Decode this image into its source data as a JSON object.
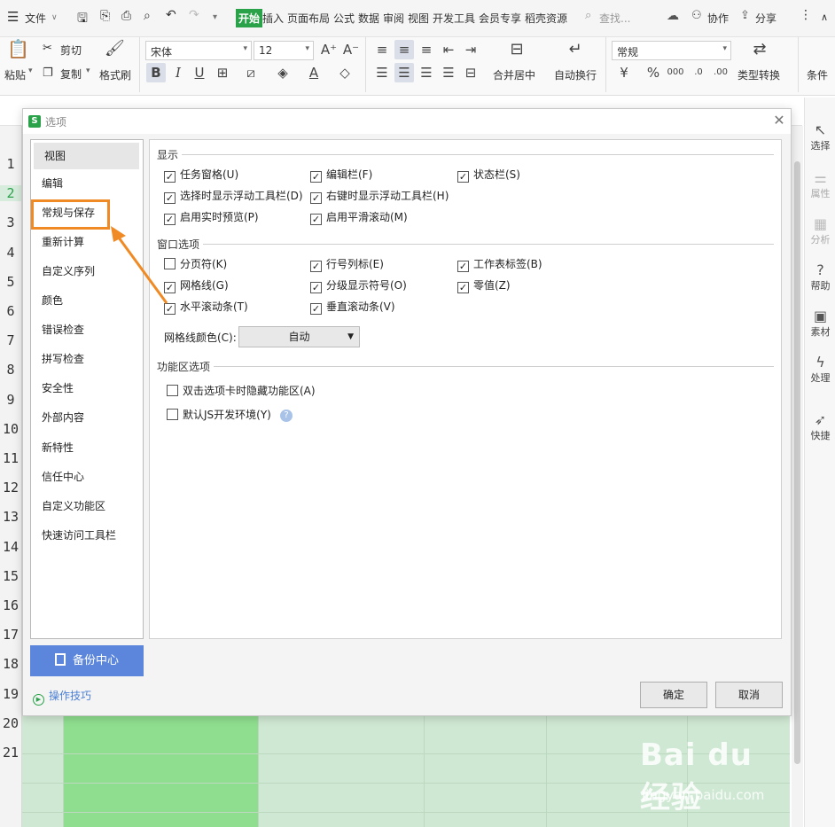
{
  "menubar": {
    "file_label": "文件",
    "tabs": [
      "开始",
      "插入",
      "页面布局",
      "公式",
      "数据",
      "审阅",
      "视图",
      "开发工具",
      "会员专享",
      "稻壳资源"
    ],
    "search_label": "查找...",
    "collab_label": "协作",
    "share_label": "分享"
  },
  "ribbon": {
    "cut": "剪切",
    "paste": "粘贴",
    "copy": "复制",
    "format_painter": "格式刷",
    "font_name": "宋体",
    "font_size": "12",
    "merge_center": "合并居中",
    "wrap_text": "自动换行",
    "number_format": "常规",
    "type_convert": "类型转换",
    "conditional": "条件"
  },
  "rows": [
    "1",
    "2",
    "3",
    "4",
    "5",
    "6",
    "7",
    "8",
    "9",
    "10",
    "11",
    "12",
    "13",
    "14",
    "15",
    "16",
    "17",
    "18",
    "19",
    "20",
    "21"
  ],
  "sidepanel": {
    "items": [
      "选择",
      "属性",
      "分析",
      "帮助",
      "素材",
      "处理",
      "快捷"
    ]
  },
  "dialog": {
    "title": "选项",
    "nav": [
      "视图",
      "编辑",
      "常规与保存",
      "重新计算",
      "自定义序列",
      "颜色",
      "错误检查",
      "拼写检查",
      "安全性",
      "外部内容",
      "新特性",
      "信任中心",
      "自定义功能区",
      "快速访问工具栏"
    ],
    "backup_label": "备份中心",
    "tips_label": "操作技巧",
    "sections": {
      "display": "显示",
      "window": "窗口选项",
      "function": "功能区选项"
    },
    "display_options": [
      {
        "label": "任务窗格(U)",
        "checked": true
      },
      {
        "label": "编辑栏(F)",
        "checked": true
      },
      {
        "label": "状态栏(S)",
        "checked": true
      },
      {
        "label": "选择时显示浮动工具栏(D)",
        "checked": true
      },
      {
        "label": "右键时显示浮动工具栏(H)",
        "checked": true
      },
      {
        "label": "启用实时预览(P)",
        "checked": true
      },
      {
        "label": "启用平滑滚动(M)",
        "checked": true
      }
    ],
    "window_options": [
      {
        "label": "分页符(K)",
        "checked": false
      },
      {
        "label": "行号列标(E)",
        "checked": true
      },
      {
        "label": "工作表标签(B)",
        "checked": true
      },
      {
        "label": "网格线(G)",
        "checked": true
      },
      {
        "label": "分级显示符号(O)",
        "checked": true
      },
      {
        "label": "零值(Z)",
        "checked": true
      },
      {
        "label": "水平滚动条(T)",
        "checked": true
      },
      {
        "label": "垂直滚动条(V)",
        "checked": true
      }
    ],
    "gridline_color_label": "网格线颜色(C):",
    "gridline_color_value": "自动",
    "function_options": [
      {
        "label": "双击选项卡时隐藏功能区(A)",
        "checked": false
      },
      {
        "label": "默认JS开发环境(Y)",
        "checked": false
      }
    ],
    "ok_label": "确定",
    "cancel_label": "取消"
  },
  "watermark": {
    "logo": "Bai du 经验",
    "url": "jingyan.baidu.com"
  },
  "colors": {
    "accent_green": "#2aa24a",
    "highlight_orange": "#f08a24",
    "backup_blue": "#5b86db"
  }
}
